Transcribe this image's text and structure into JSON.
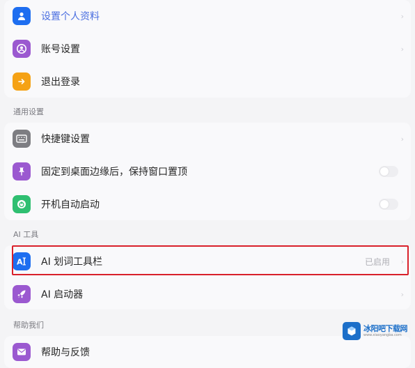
{
  "account": {
    "items": [
      {
        "label": "设置个人资料",
        "icon": "user-icon",
        "color": "#1e6ef0"
      },
      {
        "label": "账号设置",
        "icon": "account-circle-icon",
        "color": "#9b59d0"
      },
      {
        "label": "退出登录",
        "icon": "logout-arrow-icon",
        "color": "#f5a215"
      }
    ]
  },
  "general": {
    "title": "通用设置",
    "items": [
      {
        "label": "快捷键设置",
        "icon": "keyboard-icon",
        "color": "#7d7d82"
      },
      {
        "label": "固定到桌面边缘后，保持窗口置顶",
        "icon": "pin-icon",
        "color": "#9b59d0"
      },
      {
        "label": "开机自动启动",
        "icon": "power-icon",
        "color": "#2fbf71"
      }
    ]
  },
  "ai_tools": {
    "title": "AI 工具",
    "items": [
      {
        "label": "AI 划词工具栏",
        "status": "已启用",
        "icon": "ai-text-icon",
        "color": "#1e6ef0"
      },
      {
        "label": "AI 启动器",
        "icon": "rocket-icon",
        "color": "#9b59d0"
      }
    ]
  },
  "help": {
    "title": "帮助我们",
    "items": [
      {
        "label": "帮助与反馈",
        "icon": "mail-icon",
        "color": "#9b59d0"
      }
    ]
  },
  "watermark": {
    "name": "冰阳吧下载网",
    "url": "www.xiaoyangba.com"
  },
  "colors": {
    "highlight": "#d9202a",
    "link": "#4a6ee0"
  }
}
